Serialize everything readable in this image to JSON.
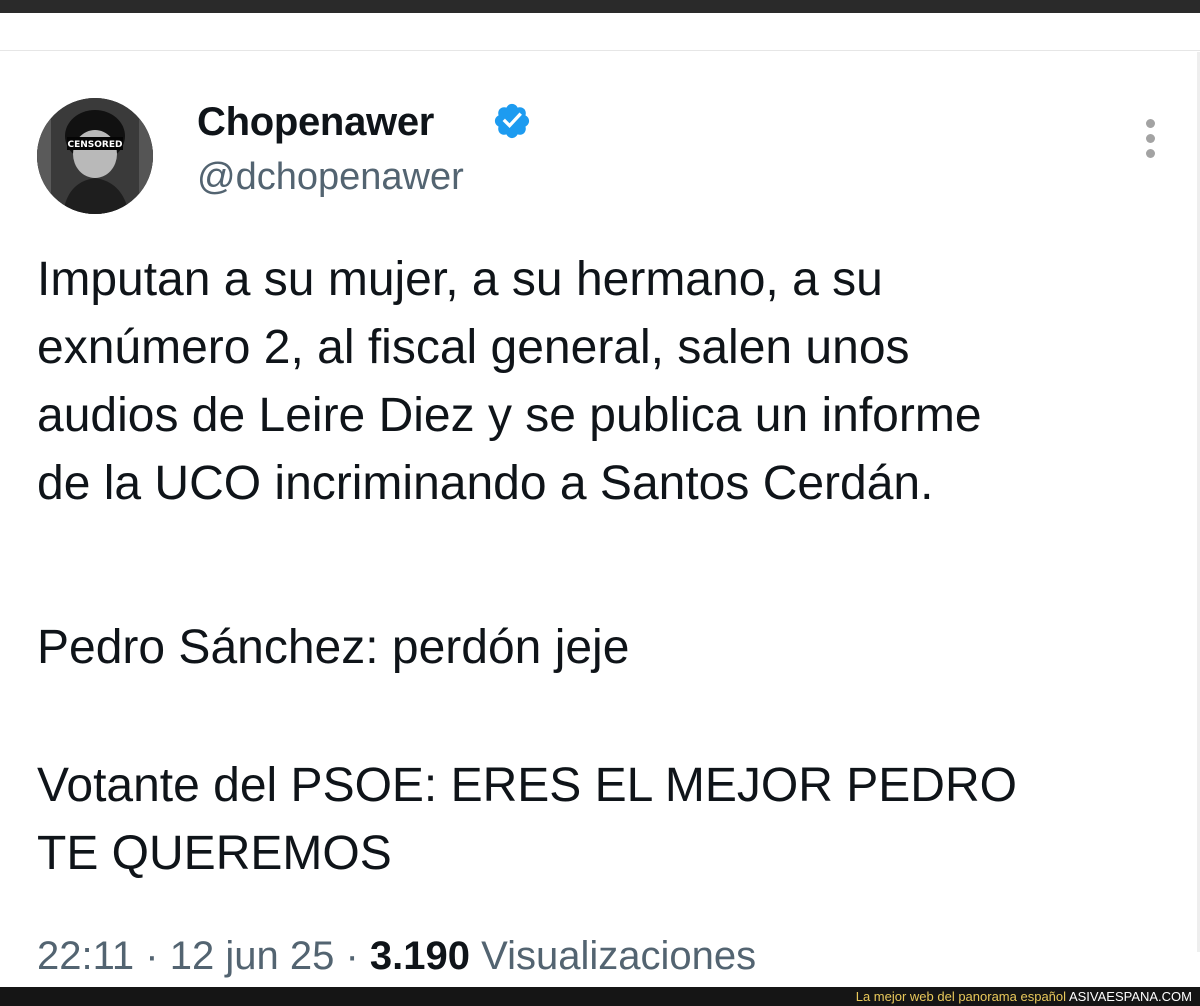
{
  "tweet": {
    "author": {
      "display_name": "Chopenawer",
      "handle": "@dchopenawer",
      "avatar_text": "CENSORED"
    },
    "text_lines": [
      "Imputan a su mujer, a su hermano, a su",
      "exnúmero 2, al fiscal general, salen unos",
      "audios de Leire Diez y se publica un informe",
      "de la UCO incriminando a Santos Cerdán."
    ],
    "text_line_2": "Pedro Sánchez: perdón jeje",
    "text_lines_3": [
      "Votante del PSOE: ERES EL MEJOR PEDRO",
      "TE QUEREMOS"
    ],
    "time": "22:11",
    "date": "12 jun 25",
    "views_count": "3.190",
    "views_label": "Visualizaciones",
    "separator": "·"
  },
  "footer": {
    "tagline": "La mejor web del panorama español",
    "site": "ASIVAESPANA.COM"
  },
  "icons": {
    "verified": "verified-badge-icon",
    "more": "more-vertical-icon"
  },
  "colors": {
    "verified_blue": "#1d9bf0",
    "secondary_text": "#536471",
    "primary_text": "#0f1419",
    "footer_tagline": "#e8c85a"
  }
}
